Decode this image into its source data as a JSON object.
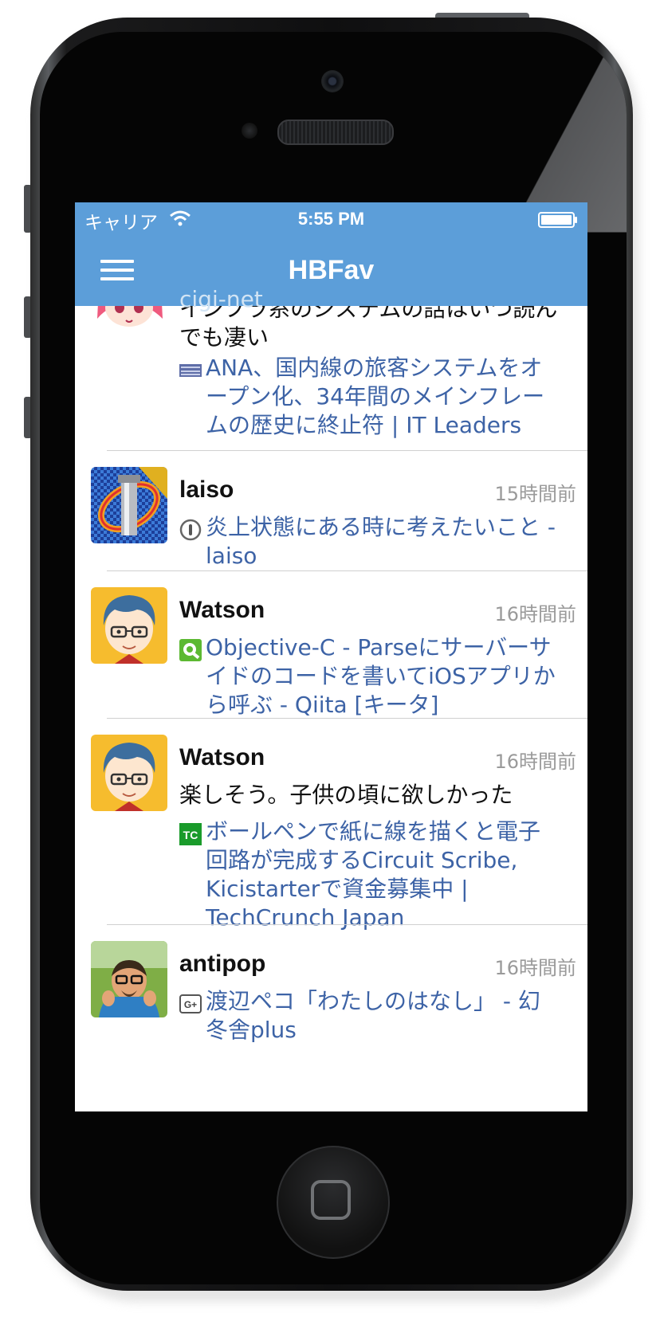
{
  "status_bar": {
    "carrier": "キャリア",
    "time": "5:55 PM"
  },
  "nav": {
    "title": "HBFav",
    "ghost_user": "cigi-net"
  },
  "feed": [
    {
      "user": "",
      "time": "",
      "comment": "インフラ系のシステムの話はいつ読んでも凄い",
      "link": "ANA、国内線の旅客システムをオープン化、34年間のメインフレームの歴史に終止符 | IT Leaders"
    },
    {
      "user": "laiso",
      "time": "15時間前",
      "comment": "",
      "link": "炎上状態にある時に考えたいこと - laiso"
    },
    {
      "user": "Watson",
      "time": "16時間前",
      "comment": "",
      "link": "Objective-C - Parseにサーバーサイドのコードを書いてiOSアプリから呼ぶ - Qiita [キータ]"
    },
    {
      "user": "Watson",
      "time": "16時間前",
      "comment": "楽しそう。子供の頃に欲しかった",
      "link": "ボールペンで紙に線を描くと電子回路が完成するCircuit Scribe, Kicistarterで資金募集中 | TechCrunch Japan"
    },
    {
      "user": "antipop",
      "time": "16時間前",
      "comment": "",
      "link": "渡辺ペコ「わたしのはなし」 - 幻冬舎plus"
    }
  ],
  "favicons": {
    "itleaders": "IT Leaders favicon",
    "tc_label": "TC",
    "gplus_label": "G+"
  },
  "colors": {
    "nav_bar": "#5c9ed9",
    "link": "#3d63a6",
    "time": "#9a9a9a"
  }
}
